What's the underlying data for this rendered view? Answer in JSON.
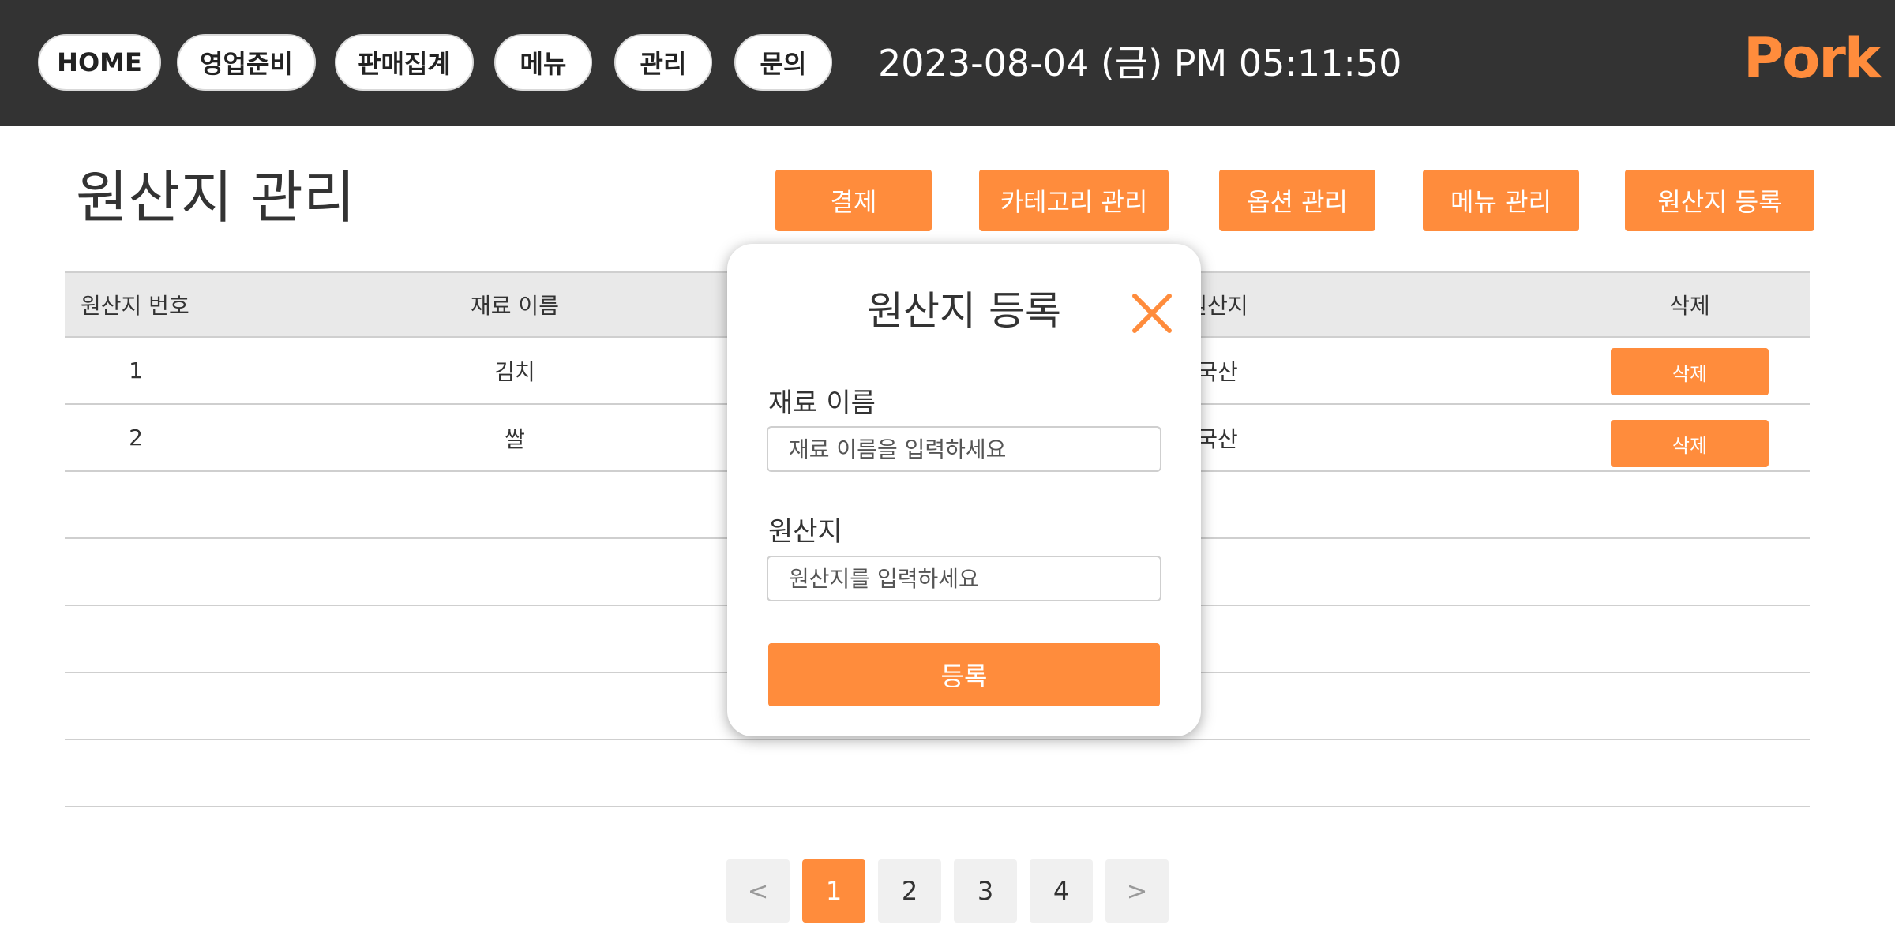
{
  "nav": {
    "home": "HOME",
    "prep": "영업준비",
    "sales": "판매집계",
    "menu": "메뉴",
    "manage": "관리",
    "inquiry": "문의"
  },
  "datetime": "2023-08-04 (금) PM 05:11:50",
  "logo": "Pork",
  "page": {
    "title": "원산지 관리",
    "actions": {
      "payment": "결제",
      "category": "카테고리 관리",
      "option": "옵션 관리",
      "menu": "메뉴 관리",
      "origin_register": "원산지 등록"
    }
  },
  "table": {
    "headers": [
      "원산지 번호",
      "재료 이름",
      "원산지",
      "삭제"
    ],
    "rows": [
      {
        "no": "1",
        "ingredient": "김치",
        "origin": "국산",
        "delete": "삭제"
      },
      {
        "no": "2",
        "ingredient": "쌀",
        "origin": "국산",
        "delete": "삭제"
      }
    ]
  },
  "pagination": {
    "prev": "<",
    "pages": [
      "1",
      "2",
      "3",
      "4"
    ],
    "next": ">",
    "current": "1"
  },
  "modal": {
    "title": "원산지 등록",
    "close_icon": "close-icon",
    "ingredient_label": "재료 이름",
    "ingredient_placeholder": "재료 이름을 입력하세요",
    "origin_label": "원산지",
    "origin_placeholder": "원산지를 입력하세요",
    "submit": "등록"
  },
  "colors": {
    "accent": "#ff8c3c",
    "topbar": "#333333",
    "table_header": "#e9e9e9"
  }
}
